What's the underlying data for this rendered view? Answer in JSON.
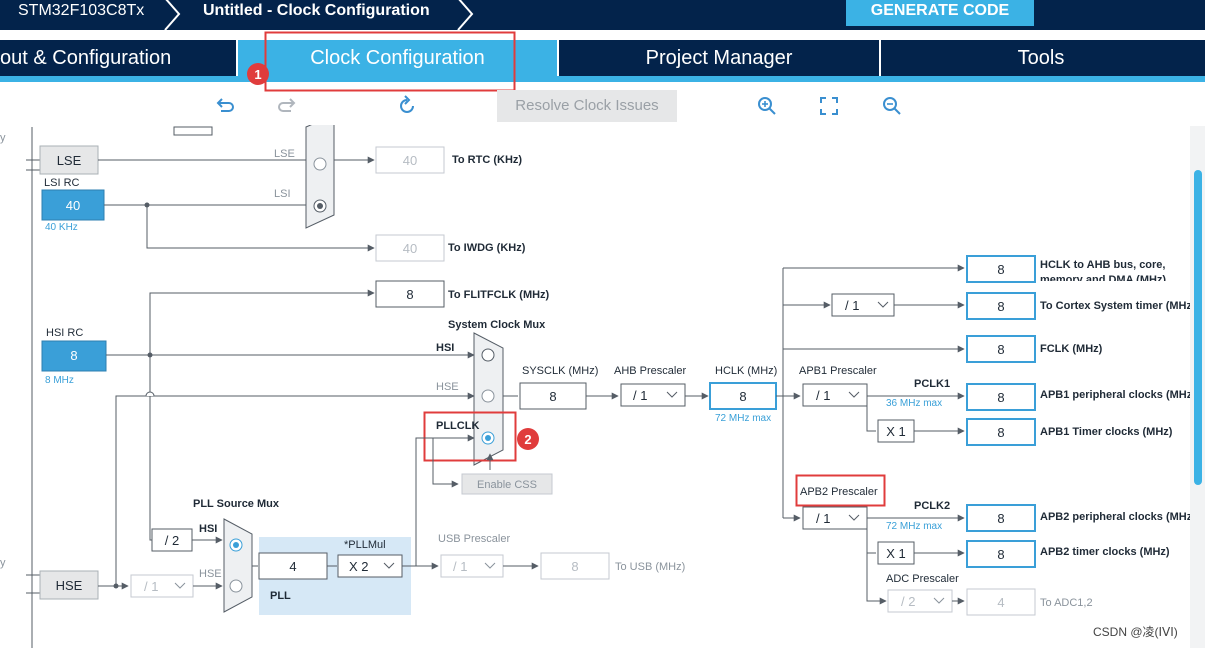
{
  "breadcrumb": {
    "device": "STM32F103C8Tx",
    "current": "Untitled - Clock Configuration"
  },
  "generate_button": "GENERATE CODE",
  "tabs": [
    {
      "label": "out & Configuration",
      "active": false
    },
    {
      "label": "Clock Configuration",
      "active": true
    },
    {
      "label": "Project Manager",
      "active": false
    },
    {
      "label": "Tools",
      "active": false
    }
  ],
  "annotations": {
    "marker1": "1",
    "marker2": "2"
  },
  "toolbar": {
    "undo_icon": "undo-icon",
    "redo_icon": "redo-icon",
    "reset_icon": "refresh-icon",
    "resolve_label": "Resolve Clock Issues",
    "zoom_in_icon": "zoom-in-icon",
    "fit_icon": "fit-screen-icon",
    "zoom_out_icon": "zoom-out-icon"
  },
  "diagram": {
    "lse": {
      "label": "LSE",
      "line_label": "LSE"
    },
    "lsi": {
      "title": "LSI RC",
      "value": "40",
      "freq": "40 KHz",
      "line_label": "LSI"
    },
    "rtc": {
      "value": "40",
      "label": "To RTC (KHz)"
    },
    "iwdg": {
      "value": "40",
      "label": "To IWDG (KHz)"
    },
    "flitf": {
      "value": "8",
      "label": "To FLITFCLK (MHz)"
    },
    "hsi": {
      "title": "HSI RC",
      "value": "8",
      "freq": "8 MHz"
    },
    "sysmux": {
      "title": "System Clock Mux",
      "hsi": "HSI",
      "hse": "HSE",
      "pllclk": "PLLCLK"
    },
    "sysclk": {
      "label": "SYSCLK (MHz)",
      "value": "8"
    },
    "ahb": {
      "label": "AHB Prescaler",
      "value": "/ 1"
    },
    "hclk": {
      "label": "HCLK (MHz)",
      "value": "8",
      "max": "72 MHz max"
    },
    "css": "Enable CSS",
    "apb1": {
      "label": "APB1 Prescaler",
      "value": "/ 1",
      "pclk": "PCLK1",
      "max": "36 MHz max",
      "timer_mult": "X 1"
    },
    "apb2": {
      "label": "APB2 Prescaler",
      "value": "/ 1",
      "pclk": "PCLK2",
      "max": "72 MHz max",
      "timer_mult": "X 1"
    },
    "cortex_div": "/ 1",
    "outputs": {
      "hclk_ahb": {
        "value": "8",
        "label1": "HCLK to AHB bus, core,",
        "label2": "memory and DMA (MHz)"
      },
      "cortex": {
        "value": "8",
        "label": "To Cortex System timer (MHz)"
      },
      "fclk": {
        "value": "8",
        "label": "FCLK (MHz)"
      },
      "apb1_periph": {
        "value": "8",
        "label": "APB1 peripheral clocks (MHz)"
      },
      "apb1_timer": {
        "value": "8",
        "label": "APB1 Timer clocks (MHz)"
      },
      "apb2_periph": {
        "value": "8",
        "label": "APB2 peripheral clocks (MHz)"
      },
      "apb2_timer": {
        "value": "8",
        "label": "APB2 timer clocks (MHz)"
      }
    },
    "adc": {
      "label": "ADC Prescaler",
      "value": "/ 2",
      "out_value": "4",
      "out_label": "To ADC1,2"
    },
    "pll_src": {
      "title": "PLL Source Mux",
      "hsi": "HSI",
      "hse": "HSE",
      "div2": "/ 2"
    },
    "hse": {
      "label": "HSE",
      "div": "/ 1"
    },
    "pll": {
      "value": "4",
      "mul_label": "*PLLMul",
      "mul": "X 2",
      "title": "PLL"
    },
    "usb": {
      "label": "USB Prescaler",
      "value": "/ 1",
      "out_value": "8",
      "out_label": "To USB (MHz)"
    },
    "edge_text": {
      "top": "y",
      "bottom": "y"
    }
  },
  "watermark": "CSDN @凌(ⅠⅤⅠ)",
  "colors": {
    "navy": "#03234b",
    "accent": "#3bb2e5",
    "highlight_red": "#e03c3c",
    "source_blue": "#3a9fd8"
  }
}
